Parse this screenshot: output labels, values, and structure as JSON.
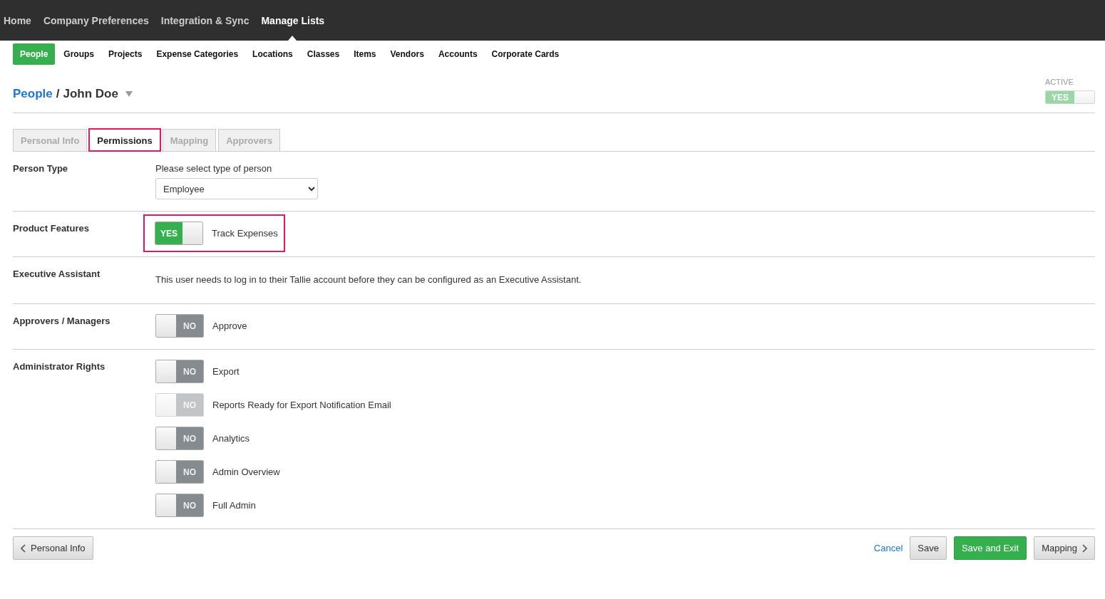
{
  "top_nav": [
    {
      "label": "Home",
      "selected": false
    },
    {
      "label": "Company Preferences",
      "selected": false
    },
    {
      "label": "Integration & Sync",
      "selected": false
    },
    {
      "label": "Manage Lists",
      "selected": true
    }
  ],
  "sub_nav": [
    {
      "label": "People",
      "selected": true
    },
    {
      "label": "Groups",
      "selected": false
    },
    {
      "label": "Projects",
      "selected": false
    },
    {
      "label": "Expense Categories",
      "selected": false
    },
    {
      "label": "Locations",
      "selected": false
    },
    {
      "label": "Classes",
      "selected": false
    },
    {
      "label": "Items",
      "selected": false
    },
    {
      "label": "Vendors",
      "selected": false
    },
    {
      "label": "Accounts",
      "selected": false
    },
    {
      "label": "Corporate Cards",
      "selected": false
    }
  ],
  "breadcrumb": {
    "parent": "People",
    "separator": "/",
    "current": "John Doe"
  },
  "active": {
    "label": "ACTIVE",
    "toggle": {
      "on": true,
      "text": "YES",
      "disabled": true
    }
  },
  "tabs": [
    {
      "label": "Personal Info",
      "selected": false,
      "highlighted": false
    },
    {
      "label": "Permissions",
      "selected": true,
      "highlighted": true
    },
    {
      "label": "Mapping",
      "selected": false,
      "highlighted": false
    },
    {
      "label": "Approvers",
      "selected": false,
      "highlighted": false
    }
  ],
  "sections": [
    {
      "label": "Person Type",
      "kind": "select",
      "hint": "Please select type of person",
      "value": "Employee"
    },
    {
      "label": "Product Features",
      "kind": "toggles",
      "toggles": [
        {
          "text": "YES",
          "on": true,
          "disabled": false,
          "highlighted": true,
          "label": "Track Expenses"
        }
      ]
    },
    {
      "label": "Executive Assistant",
      "kind": "text",
      "text": "This user needs to log in to their Tallie account before they can be configured as an Executive Assistant."
    },
    {
      "label": "Approvers / Managers",
      "kind": "toggles",
      "toggles": [
        {
          "text": "NO",
          "on": false,
          "disabled": false,
          "highlighted": false,
          "label": "Approve"
        }
      ]
    },
    {
      "label": "Administrator Rights",
      "kind": "toggles",
      "toggles": [
        {
          "text": "NO",
          "on": false,
          "disabled": false,
          "highlighted": false,
          "label": "Export"
        },
        {
          "text": "NO",
          "on": false,
          "disabled": true,
          "highlighted": false,
          "label": "Reports Ready for Export Notification Email"
        },
        {
          "text": "NO",
          "on": false,
          "disabled": false,
          "highlighted": false,
          "label": "Analytics"
        },
        {
          "text": "NO",
          "on": false,
          "disabled": false,
          "highlighted": false,
          "label": "Admin Overview"
        },
        {
          "text": "NO",
          "on": false,
          "disabled": false,
          "highlighted": false,
          "label": "Full Admin"
        }
      ]
    }
  ],
  "footer": {
    "back": "Personal Info",
    "cancel": "Cancel",
    "save": "Save",
    "save_exit": "Save and Exit",
    "next": "Mapping"
  }
}
